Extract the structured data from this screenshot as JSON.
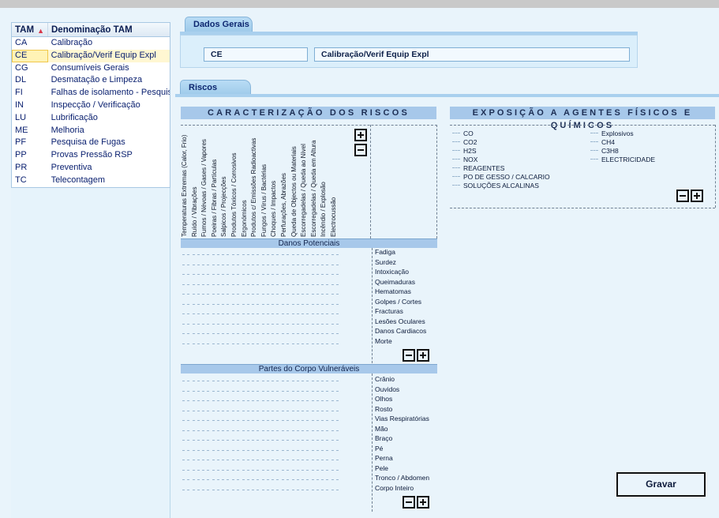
{
  "left_table": {
    "headers": {
      "code": "TAM",
      "name": "Denominação TAM"
    },
    "rows": [
      {
        "code": "CA",
        "name": "Calibração"
      },
      {
        "code": "CE",
        "name": "Calibração/Verif Equip Expl",
        "selected": true
      },
      {
        "code": "CG",
        "name": "Consumíveis Gerais"
      },
      {
        "code": "DL",
        "name": "Desmatação e Limpeza"
      },
      {
        "code": "FI",
        "name": "Falhas de isolamento - Pesquis"
      },
      {
        "code": "IN",
        "name": "Inspecção / Verificação"
      },
      {
        "code": "LU",
        "name": "Lubrificação"
      },
      {
        "code": "ME",
        "name": "Melhoria"
      },
      {
        "code": "PF",
        "name": "Pesquisa de Fugas"
      },
      {
        "code": "PP",
        "name": "Provas Pressão RSP"
      },
      {
        "code": "PR",
        "name": "Preventiva"
      },
      {
        "code": "TC",
        "name": "Telecontagem"
      }
    ]
  },
  "tabs": {
    "dados_gerais": "Dados Gerais",
    "riscos": "Riscos"
  },
  "dados_gerais": {
    "code": "CE",
    "description": "Calibração/Verif Equip Expl"
  },
  "riscos": {
    "title": "CARACTERIZAÇÃO DOS RISCOS",
    "risk_columns": [
      "Temperaturas Extremas (Calor, Frio)",
      "Ruído / Vibrações",
      "Fumos / Névoas / Gases / Vapores",
      "Poeiras / Fibras / Partículas",
      "Salpicos / Projecções",
      "Produtos Tóxicos / Corrosivos",
      "Ergonómicos",
      "Produtos c/ Emissões Radioactivas",
      "Fungos / Vírus / Bactérias",
      "Choques / Impactos",
      "Perfurações, Abrazões",
      "Queda de Objectos ou Materiais",
      "Escorregadelas / Queda ao Nível",
      "Escorregadelas / Queda em Altura",
      "Incêndio / Explosão",
      "Electrocussão"
    ],
    "danos_title": "Danos Potenciais",
    "danos": [
      "Fadiga",
      "Surdez",
      "Intoxicação",
      "Queimaduras",
      "Hematomas",
      "Golpes / Cortes",
      "Fracturas",
      "Lesões Oculares",
      "Danos Cardiacos",
      "Morte"
    ],
    "partes_title": "Partes do Corpo Vulneráveis",
    "partes": [
      "Crânio",
      "Ouvidos",
      "Olhos",
      "Rosto",
      "Vias Respiratórias",
      "Mão",
      "Braço",
      "Pé",
      "Perna",
      "Pele",
      "Tronco / Abdomen",
      "Corpo Inteiro"
    ]
  },
  "exposicao": {
    "title": "EXPOSIÇÃO A AGENTES FÍSICOS E QUÍMICOS",
    "col1": [
      "CO",
      "CO2",
      "H2S",
      "NOX",
      "REAGENTES",
      "PO DE GESSO / CALCARIO",
      "SOLUÇÕES ALCALINAS"
    ],
    "col2": [
      "Explosivos",
      "CH4",
      "C3H8",
      "ELECTRICIDADE"
    ]
  },
  "gravar_label": "Gravar"
}
